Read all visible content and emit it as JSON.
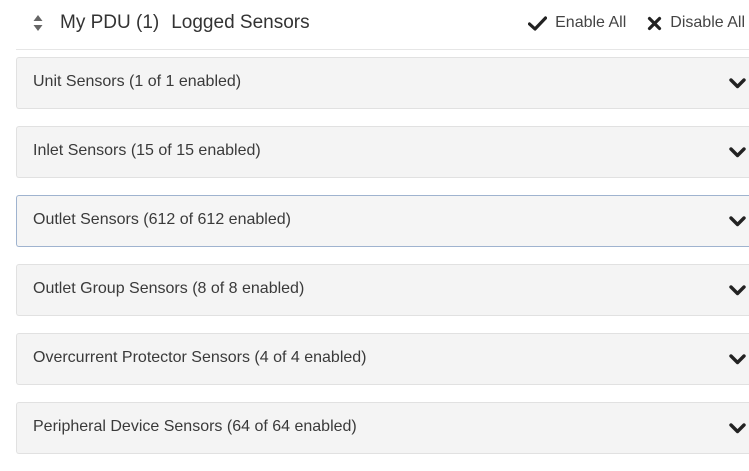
{
  "header": {
    "device_name": "My PDU (1)",
    "title": "Logged Sensors",
    "selector_icon": "sort-updown-icon",
    "enable_all_label": "Enable All",
    "enable_all_icon": "checkmark-icon",
    "disable_all_label": "Disable All",
    "disable_all_icon": "x-icon"
  },
  "panels": [
    {
      "label": "Unit Sensors (1 of 1 enabled)",
      "icon": "chevron-down-icon"
    },
    {
      "label": "Inlet Sensors (15 of 15 enabled)",
      "icon": "chevron-down-icon"
    },
    {
      "label": "Outlet Sensors (612 of 612 enabled)",
      "icon": "chevron-down-icon",
      "focused": true
    },
    {
      "label": "Outlet Group Sensors (8 of 8 enabled)",
      "icon": "chevron-down-icon"
    },
    {
      "label": "Overcurrent Protector Sensors (4 of 4 enabled)",
      "icon": "chevron-down-icon"
    },
    {
      "label": "Peripheral Device Sensors (64 of 64 enabled)",
      "icon": "chevron-down-icon"
    }
  ],
  "colors": {
    "panel_background": "#f4f4f4",
    "panel_border": "#e1e1e1",
    "focus_border": "#9fb3cf",
    "text": "#333333"
  }
}
